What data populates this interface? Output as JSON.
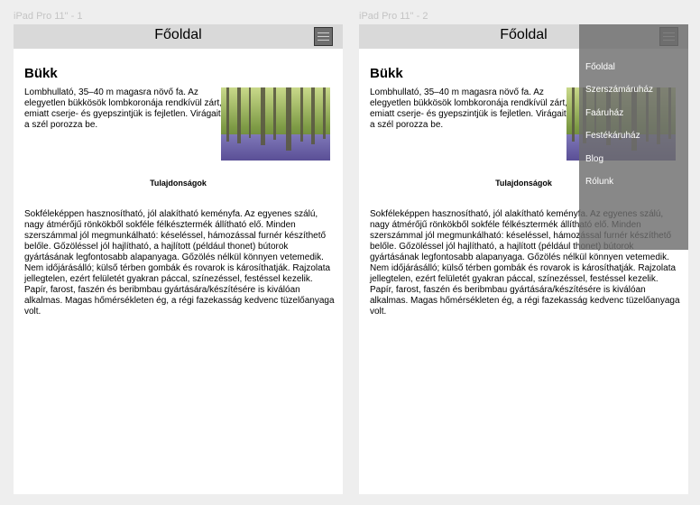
{
  "frames": [
    {
      "label": "iPad Pro 11\" - 1",
      "header_title": "Főoldal",
      "page_title": "Bükk",
      "intro": "Lombhullató, 35–40 m magasra növő fa. Az elegyetlen bükkösök lombkoronája rendkívül zárt, emiatt cserje- és gyepszintjük is fejletlen. Virágait a szél porozza be.",
      "section_heading": "Tulajdonságok",
      "body": "Sokféleképpen hasznosítható, jól alakítható keményfa. Az egyenes szálú, nagy átmérőjű rönkökből sokféle félkésztermék állítható elő. Minden szerszámmal jól megmunkálható: késeléssel, hámozással furnér készíthető belőle. Gőzöléssel jól hajlítható, a hajlított (például thonet) bútorok gyártásának legfontosabb alapanyaga. Gőzölés nélkül könnyen vetemedik. Nem időjárásálló; külső térben gombák és rovarok is károsíthatják. Rajzolata jellegtelen, ezért felületét gyakran páccal, színezéssel, festéssel kezelik. Papír, farost, faszén és beribmbau gyártására/készítésére is kiválóan alkalmas. Magas hőmérsékleten ég, a régi fazekasság kedvenc tüzelőanyaga volt."
    },
    {
      "label": "iPad Pro 11\" - 2",
      "header_title": "Főoldal",
      "page_title": "Bükk",
      "intro": "Lombhullató, 35–40 m magasra növő fa. Az elegyetlen bükkösök lombkoronája rendkívül zárt, emiatt cserje- és gyepszintjük is fejletlen. Virágait a szél porozza be.",
      "section_heading": "Tulajdonságok",
      "body": "Sokféleképpen hasznosítható, jól alakítható keményfa. Az egyenes szálú, nagy átmérőjű rönkökből sokféle félkésztermék állítható elő. Minden szerszámmal jól megmunkálható: késeléssel, hámozással furnér készíthető belőle. Gőzöléssel jól hajlítható, a hajlított (például thonet) bútorok gyártásának legfontosabb alapanyaga. Gőzölés nélkül könnyen vetemedik. Nem időjárásálló; külső térben gombák és rovarok is károsíthatják. Rajzolata jellegtelen, ezért felületét gyakran páccal, színezéssel, festéssel kezelik. Papír, farost, faszén és beribmbau gyártására/készítésére is kiválóan alkalmas. Magas hőmérsékleten ég, a régi fazekasság kedvenc tüzelőanyaga volt.",
      "menu": [
        "Főoldal",
        "Szerszámáruház",
        "Faáruház",
        "Festékáruház",
        "Blog",
        "Rólunk"
      ]
    }
  ],
  "icons": {
    "menu_button": "hamburger-menu-icon",
    "photo": "beech-forest-photo"
  },
  "colors": {
    "canvas": "#eeeeee",
    "header": "#d9d9d9",
    "page": "#ffffff",
    "menu_overlay": "#6e6e6e"
  }
}
